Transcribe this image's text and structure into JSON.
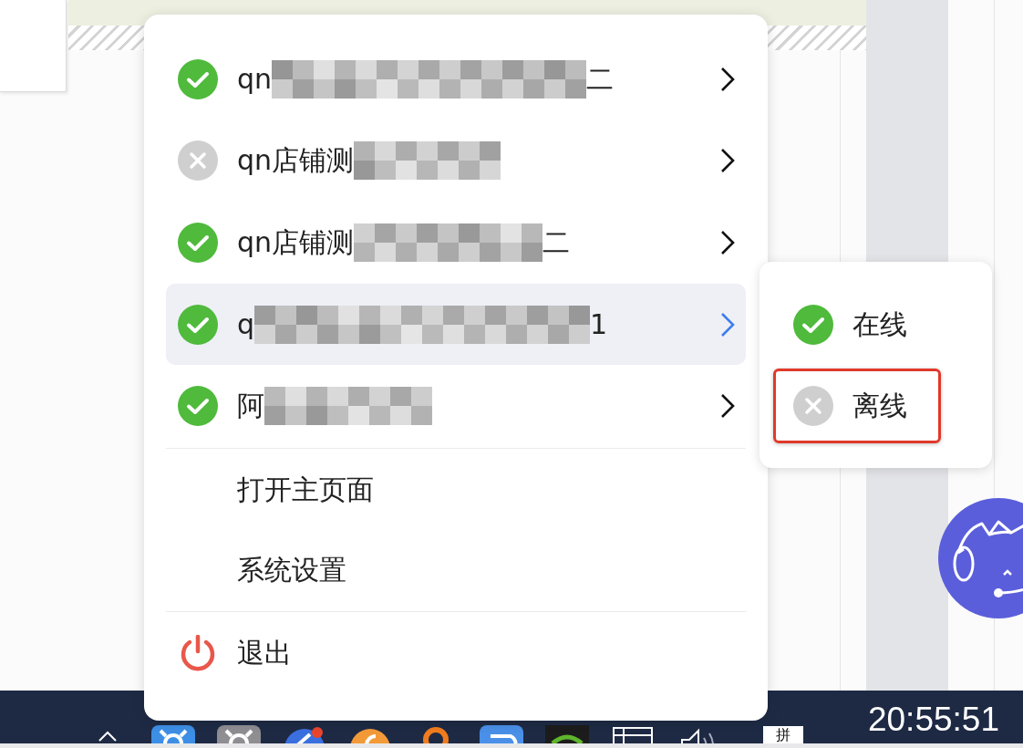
{
  "menu": {
    "accounts": [
      {
        "name_start": "qn",
        "name_end": "二",
        "online": true,
        "expanded": false
      },
      {
        "name_start": "qn店铺测",
        "online": false,
        "expanded": false
      },
      {
        "name_start": "qn店铺测",
        "name_end": "二",
        "online": true,
        "expanded": false
      },
      {
        "name_start": "q",
        "name_end": "1",
        "online": true,
        "expanded": true
      },
      {
        "name_start": "阿",
        "online": true,
        "expanded": false
      }
    ],
    "action_groups": [
      {
        "items": [
          {
            "label": "打开主页面",
            "kind": "plain"
          },
          {
            "label": "系统设置",
            "kind": "plain"
          }
        ]
      },
      {
        "items": [
          {
            "label": "退出",
            "kind": "exit"
          }
        ]
      }
    ]
  },
  "submenu": {
    "items": [
      {
        "label": "在线",
        "online": true,
        "highlighted": false
      },
      {
        "label": "离线",
        "online": false,
        "highlighted": true
      }
    ]
  },
  "taskbar": {
    "input_method": "拼",
    "clock": "20:55:51"
  }
}
